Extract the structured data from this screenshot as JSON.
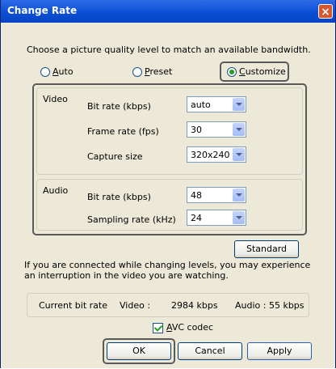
{
  "window": {
    "title": "Change Rate",
    "close_glyph": "×"
  },
  "instruction": "Choose a picture quality level to match an available bandwidth.",
  "mode": {
    "auto_first": "A",
    "auto_rest": "uto",
    "preset_first": "P",
    "preset_rest": "reset",
    "customize_first": "C",
    "customize_rest": "ustomize",
    "selected": "Customize"
  },
  "video": {
    "label": "Video",
    "bit_rate_label": "Bit rate (kbps)",
    "bit_rate_value": "auto",
    "frame_rate_label": "Frame rate (fps)",
    "frame_rate_value": "30",
    "capture_size_label": "Capture size",
    "capture_size_value": "320x240"
  },
  "audio": {
    "label": "Audio",
    "bit_rate_label": "Bit rate (kbps)",
    "bit_rate_value": "48",
    "sampling_rate_label": "Sampling rate (kHz)",
    "sampling_rate_value": "24"
  },
  "standard_label": "Standard",
  "note_line1": "If you are connected while changing levels, you may experience",
  "note_line2": "an interruption in the video you are watching.",
  "status": {
    "label": "Current bit rate",
    "video_label": "Video :",
    "video_value": "2984 kbps",
    "audio_text": "Audio : 55 kbps"
  },
  "avc": {
    "first": "A",
    "rest": "VC codec",
    "checked": true
  },
  "buttons": {
    "ok": "OK",
    "cancel": "Cancel",
    "apply": "Apply"
  }
}
